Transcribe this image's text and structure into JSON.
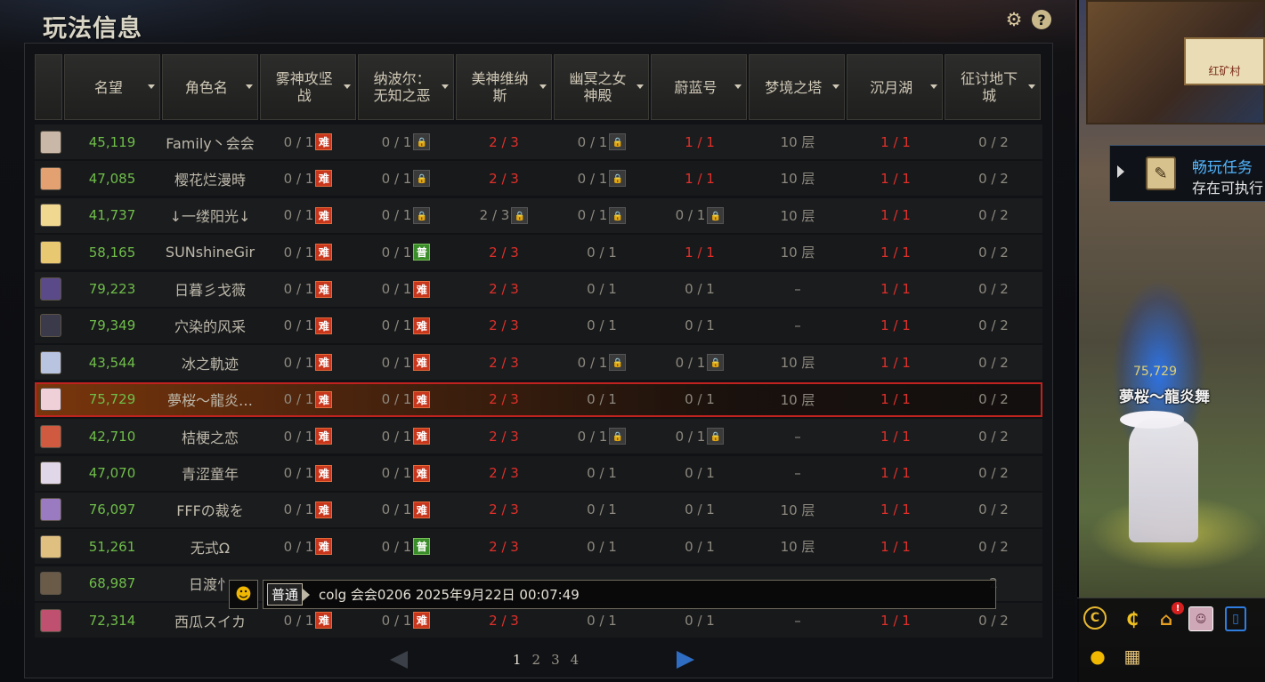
{
  "panel": {
    "title": "玩法信息",
    "gear_icon": "gear-icon",
    "help_label": "?"
  },
  "table": {
    "headers": [
      {
        "label": "名望"
      },
      {
        "label": "角色名"
      },
      {
        "label": "雾神攻坚战"
      },
      {
        "label": "纳波尔：无知之恶"
      },
      {
        "label": "美神维纳斯"
      },
      {
        "label": "幽冥之女神殿"
      },
      {
        "label": "蔚蓝号"
      },
      {
        "label": "梦境之塔"
      },
      {
        "label": "沉月湖"
      },
      {
        "label": "征讨地下城"
      }
    ],
    "rows": [
      {
        "fame": "45,119",
        "name": "Family丶会会",
        "c3": "0 / 1",
        "c3b": "难",
        "c4": "0 / 1",
        "c4b": "🔒",
        "c5": "2 / 3",
        "c5b": "",
        "c6": "0 / 1",
        "c6b": "🔒",
        "c7": "1 / 1",
        "c7b": "",
        "c8": "10 层",
        "c9": "1 / 1",
        "c10": "0 / 2",
        "avatar": "#c9b7a8"
      },
      {
        "fame": "47,085",
        "name": "樱花烂漫時",
        "c3": "0 / 1",
        "c3b": "难",
        "c4": "0 / 1",
        "c4b": "🔒",
        "c5": "2 / 3",
        "c5b": "",
        "c6": "0 / 1",
        "c6b": "🔒",
        "c7": "1 / 1",
        "c7b": "",
        "c8": "10 层",
        "c9": "1 / 1",
        "c10": "0 / 2",
        "avatar": "#e3a070"
      },
      {
        "fame": "41,737",
        "name": "↓一缕阳光↓",
        "c3": "0 / 1",
        "c3b": "难",
        "c4": "0 / 1",
        "c4b": "🔒",
        "c5": "2 / 3",
        "c5b": "🔒",
        "c6": "0 / 1",
        "c6b": "🔒",
        "c7": "0 / 1",
        "c7b": "🔒",
        "c8": "10 层",
        "c9": "1 / 1",
        "c10": "0 / 2",
        "avatar": "#f0d890"
      },
      {
        "fame": "58,165",
        "name": "SUNshineGir",
        "c3": "0 / 1",
        "c3b": "难",
        "c4": "0 / 1",
        "c4b": "普",
        "c5": "2 / 3",
        "c5b": "",
        "c6": "0 / 1",
        "c6b": "",
        "c7": "1 / 1",
        "c7b": "",
        "c8": "10 层",
        "c9": "1 / 1",
        "c10": "0 / 2",
        "avatar": "#e8c870"
      },
      {
        "fame": "79,223",
        "name": "日暮彡戈薇",
        "c3": "0 / 1",
        "c3b": "难",
        "c4": "0 / 1",
        "c4b": "难",
        "c5": "2 / 3",
        "c5b": "",
        "c6": "0 / 1",
        "c6b": "",
        "c7": "0 / 1",
        "c7b": "",
        "c8": "–",
        "c9": "1 / 1",
        "c10": "0 / 2",
        "avatar": "#5a4a8a"
      },
      {
        "fame": "79,349",
        "name": "穴染的风采",
        "c3": "0 / 1",
        "c3b": "难",
        "c4": "0 / 1",
        "c4b": "难",
        "c5": "2 / 3",
        "c5b": "",
        "c6": "0 / 1",
        "c6b": "",
        "c7": "0 / 1",
        "c7b": "",
        "c8": "–",
        "c9": "1 / 1",
        "c10": "0 / 2",
        "avatar": "#3a3a4a"
      },
      {
        "fame": "43,544",
        "name": "冰之軌迹",
        "c3": "0 / 1",
        "c3b": "难",
        "c4": "0 / 1",
        "c4b": "难",
        "c5": "2 / 3",
        "c5b": "",
        "c6": "0 / 1",
        "c6b": "🔒",
        "c7": "0 / 1",
        "c7b": "🔒",
        "c8": "10 层",
        "c9": "1 / 1",
        "c10": "0 / 2",
        "avatar": "#b8c4e0"
      },
      {
        "fame": "75,729",
        "name": "夢桜～龍炎…",
        "c3": "0 / 1",
        "c3b": "难",
        "c4": "0 / 1",
        "c4b": "难",
        "c5": "2 / 3",
        "c5b": "",
        "c6": "0 / 1",
        "c6b": "",
        "c7": "0 / 1",
        "c7b": "",
        "c8": "10 层",
        "c9": "1 / 1",
        "c10": "0 / 2",
        "avatar": "#f0d0d8",
        "selected": true
      },
      {
        "fame": "42,710",
        "name": "桔梗之恋",
        "c3": "0 / 1",
        "c3b": "难",
        "c4": "0 / 1",
        "c4b": "难",
        "c5": "2 / 3",
        "c5b": "",
        "c6": "0 / 1",
        "c6b": "🔒",
        "c7": "0 / 1",
        "c7b": "🔒",
        "c8": "–",
        "c9": "1 / 1",
        "c10": "0 / 2",
        "avatar": "#d05a40"
      },
      {
        "fame": "47,070",
        "name": "青涩童年",
        "c3": "0 / 1",
        "c3b": "难",
        "c4": "0 / 1",
        "c4b": "难",
        "c5": "2 / 3",
        "c5b": "",
        "c6": "0 / 1",
        "c6b": "",
        "c7": "0 / 1",
        "c7b": "",
        "c8": "–",
        "c9": "1 / 1",
        "c10": "0 / 2",
        "avatar": "#e0d8e8"
      },
      {
        "fame": "76,097",
        "name": "FFFの裁を",
        "c3": "0 / 1",
        "c3b": "难",
        "c4": "0 / 1",
        "c4b": "难",
        "c5": "2 / 3",
        "c5b": "",
        "c6": "0 / 1",
        "c6b": "",
        "c7": "0 / 1",
        "c7b": "",
        "c8": "10 层",
        "c9": "1 / 1",
        "c10": "0 / 2",
        "avatar": "#9a7ac0"
      },
      {
        "fame": "51,261",
        "name": "无式Ω",
        "c3": "0 / 1",
        "c3b": "难",
        "c4": "0 / 1",
        "c4b": "普",
        "c5": "2 / 3",
        "c5b": "",
        "c6": "0 / 1",
        "c6b": "",
        "c7": "0 / 1",
        "c7b": "",
        "c8": "10 层",
        "c9": "1 / 1",
        "c10": "0 / 2",
        "avatar": "#e0c080"
      },
      {
        "fame": "68,987",
        "name": "日渡忄",
        "c3": "",
        "c3b": "",
        "c4": "",
        "c4b": "",
        "c5": "",
        "c5b": "",
        "c6": "",
        "c6b": "",
        "c7": "",
        "c7b": "",
        "c8": "",
        "c9": "",
        "c10": "2",
        "avatar": "#6a5a48"
      },
      {
        "fame": "72,314",
        "name": "西瓜スイカ",
        "c3": "0 / 1",
        "c3b": "难",
        "c4": "0 / 1",
        "c4b": "难",
        "c5": "2 / 3",
        "c5b": "",
        "c6": "0 / 1",
        "c6b": "",
        "c7": "0 / 1",
        "c7b": "",
        "c8": "–",
        "c9": "1 / 1",
        "c10": "0 / 2",
        "avatar": "#c05070"
      }
    ]
  },
  "chat": {
    "icon": "chat-smiley-icon",
    "channel": "普通",
    "message": "colg 会会0206 2025年9月22日 00:07:49"
  },
  "pager": {
    "pages": [
      "1",
      "2",
      "3",
      "4"
    ],
    "current": "1"
  },
  "world": {
    "map_label": "红矿村",
    "quest_title": "畅玩任务",
    "quest_sub": "存在可执行",
    "char_fame": "75,729",
    "char_name": "夢桜～龍炎舞"
  },
  "dock": {
    "notice_count": "!",
    "items": [
      "coin-icon",
      "cera-icon",
      "home-icon",
      "avatar-icon",
      "door-icon",
      "location-pin-icon",
      "book-icon"
    ]
  },
  "colors": {
    "fame_green": "#6fbe4a",
    "progress_red": "#e0302a",
    "hard_badge": "#c8361c",
    "normal_badge": "#3a8e2a",
    "selected_outline": "#c0231f"
  }
}
